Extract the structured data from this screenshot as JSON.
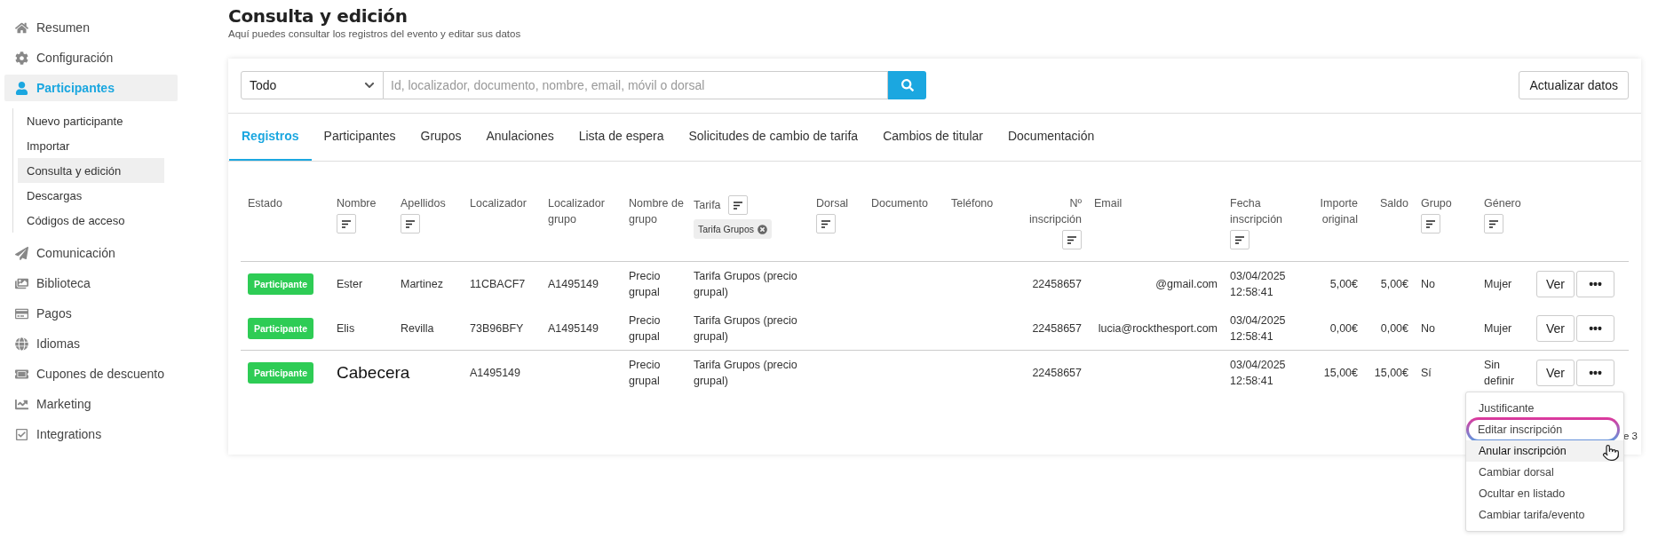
{
  "sidebar": {
    "items": [
      {
        "label": "Resumen",
        "selected": false
      },
      {
        "label": "Configuración",
        "selected": false
      },
      {
        "label": "Participantes",
        "selected": true,
        "children": [
          {
            "label": "Nuevo participante",
            "selected": false
          },
          {
            "label": "Importar",
            "selected": false
          },
          {
            "label": "Consulta y edición",
            "selected": true
          },
          {
            "label": "Descargas",
            "selected": false
          },
          {
            "label": "Códigos de acceso",
            "selected": false
          }
        ]
      },
      {
        "label": "Comunicación",
        "selected": false
      },
      {
        "label": "Biblioteca",
        "selected": false
      },
      {
        "label": "Pagos",
        "selected": false
      },
      {
        "label": "Idiomas",
        "selected": false
      },
      {
        "label": "Cupones de descuento",
        "selected": false
      },
      {
        "label": "Marketing",
        "selected": false
      },
      {
        "label": "Integrations",
        "selected": false
      }
    ]
  },
  "header": {
    "title": "Consulta y edición",
    "subtitle": "Aquí puedes consultar los registros del evento y editar sus datos"
  },
  "search": {
    "scope": "Todo",
    "placeholder": "Id, localizador, documento, nombre, email, móvil o dorsal"
  },
  "refresh_button": "Actualizar datos",
  "tabs": [
    {
      "label": "Registros",
      "selected": true
    },
    {
      "label": "Participantes",
      "selected": false
    },
    {
      "label": "Grupos",
      "selected": false
    },
    {
      "label": "Anulaciones",
      "selected": false
    },
    {
      "label": "Lista de espera",
      "selected": false
    },
    {
      "label": "Solicitudes de cambio de tarifa",
      "selected": false
    },
    {
      "label": "Cambios de titular",
      "selected": false
    },
    {
      "label": "Documentación",
      "selected": false
    }
  ],
  "table": {
    "columns": [
      {
        "label": "Estado",
        "kind": "plain"
      },
      {
        "label": "Nombre",
        "kind": "sortable"
      },
      {
        "label": "Apellidos",
        "kind": "sortable"
      },
      {
        "label": "Localizador",
        "kind": "plain"
      },
      {
        "label": "Localizador grupo",
        "kind": "plain"
      },
      {
        "label": "Nombre de grupo",
        "kind": "plain"
      },
      {
        "label": "Tarifa",
        "kind": "sortable",
        "chip": "Tarifa Grupos"
      },
      {
        "label": "Dorsal",
        "kind": "sortable"
      },
      {
        "label": "Documento",
        "kind": "plain"
      },
      {
        "label": "Teléfono",
        "kind": "plain"
      },
      {
        "label": "Nº inscripción",
        "kind": "sortable"
      },
      {
        "label": "Email",
        "kind": "plain"
      },
      {
        "label": "Fecha inscripción",
        "kind": "sortable"
      },
      {
        "label": "Importe original",
        "kind": "plain"
      },
      {
        "label": "Saldo",
        "kind": "plain"
      },
      {
        "label": "Grupo",
        "kind": "sortable"
      },
      {
        "label": "Género",
        "kind": "sortable"
      }
    ],
    "rows": [
      {
        "group_start": true,
        "cells": [
          "Participante",
          "Ester",
          "Martinez",
          "11CBACF7",
          "A1495149",
          "Precio grupal",
          "Tarifa Grupos (precio grupal)",
          null,
          null,
          null,
          "22458657",
          "@gmail.com",
          "03/04/2025 12:58:41",
          "5,00€",
          "5,00€",
          "No",
          "Mujer"
        ],
        "buttons": [
          "Ver",
          "•••"
        ]
      },
      {
        "group_start": false,
        "cells": [
          "Participante",
          "Elis",
          "Revilla",
          "73B96BFY",
          "A1495149",
          "Precio grupal",
          "Tarifa Grupos (precio grupal)",
          null,
          null,
          null,
          "22458657",
          "lucia@rockthesport.com",
          "03/04/2025 12:58:41",
          "0,00€",
          "0,00€",
          "No",
          "Mujer"
        ],
        "buttons": [
          "Ver",
          "•••"
        ]
      },
      {
        "group_start": true,
        "callout": "Cabecera",
        "cells": [
          "Participante",
          null,
          null,
          "A1495149",
          null,
          "Precio grupal",
          "Tarifa Grupos (precio grupal)",
          null,
          null,
          null,
          "22458657",
          null,
          "03/04/2025 12:58:41",
          "15,00€",
          "15,00€",
          "Sí",
          "Sin definir"
        ],
        "buttons": [
          "Ver",
          "•••"
        ]
      }
    ]
  },
  "pagination": "e 3",
  "menu": {
    "items": [
      {
        "label": "Justificante",
        "circled": false,
        "hovered": false
      },
      {
        "label": "Editar inscripción",
        "circled": true,
        "hovered": false
      },
      {
        "label": "Anular inscripción",
        "circled": false,
        "hovered": true
      },
      {
        "label": "Cambiar dorsal",
        "circled": false,
        "hovered": false
      },
      {
        "label": "Ocultar en listado",
        "circled": false,
        "hovered": false
      },
      {
        "label": "Cambiar tarifa/evento",
        "circled": false,
        "hovered": false
      }
    ]
  }
}
